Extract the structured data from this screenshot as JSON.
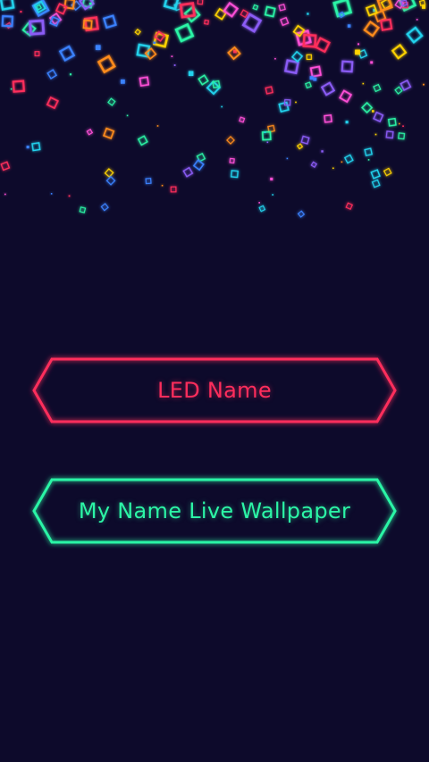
{
  "buttons": {
    "led_name": {
      "label": "LED Name",
      "color": "#ff2d5c"
    },
    "live_wallpaper": {
      "label": "My Name Live Wallpaper",
      "color": "#2cf5a6"
    }
  },
  "theme": {
    "background": "#0d0a2b",
    "confetti_colors": [
      "#ff2d5c",
      "#ff4fd8",
      "#ffd400",
      "#ff8c1a",
      "#2cf5a6",
      "#3b82ff",
      "#8b5cf6",
      "#22d3ee"
    ]
  }
}
